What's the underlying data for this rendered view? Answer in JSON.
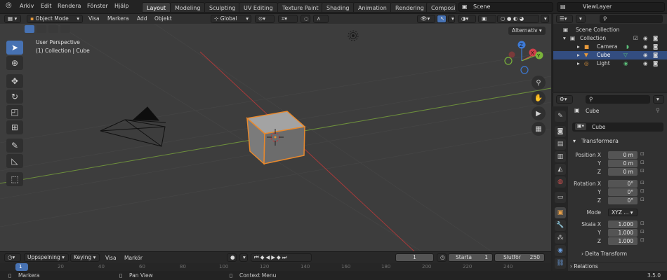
{
  "menubar": {
    "items": [
      "Arkiv",
      "Edit",
      "Rendera",
      "Fönster",
      "Hjälp"
    ],
    "workspace_tabs": [
      "Layout",
      "Modeling",
      "Sculpting",
      "UV Editing",
      "Texture Paint",
      "Shading",
      "Animation",
      "Rendering",
      "Composi"
    ],
    "active_tab": "Layout",
    "scene": "Scene",
    "view_layer": "ViewLayer"
  },
  "viewport_header": {
    "mode": "Object Mode",
    "menus": [
      "Visa",
      "Markera",
      "Add",
      "Objekt"
    ],
    "transform_orientation": "Global"
  },
  "viewport": {
    "view_name": "User Perspective",
    "collection_info": "(1) Collection | Cube",
    "options_button": "Alternativ",
    "gizmo_axes": {
      "x": "X",
      "y": "Y",
      "z": "Z"
    },
    "colors": {
      "x_axis": "#d0404a",
      "y_axis": "#7ab33a",
      "z_axis": "#3d7ad6",
      "selection": "#e8892d"
    }
  },
  "outliner": {
    "root": "Scene Collection",
    "collection": "Collection",
    "objects": [
      {
        "name": "Camera",
        "icon": "camera-icon"
      },
      {
        "name": "Cube",
        "icon": "mesh-icon",
        "selected": true
      },
      {
        "name": "Light",
        "icon": "light-icon"
      }
    ]
  },
  "properties": {
    "object_name": "Cube",
    "datablock_name": "Cube",
    "panel_title": "Transformera",
    "location": {
      "label": "Position X",
      "x": "0 m",
      "y": "0 m",
      "z": "0 m"
    },
    "rotation": {
      "label": "Rotation X",
      "x": "0°",
      "y": "0°",
      "z": "0°"
    },
    "mode": {
      "label": "Mode",
      "value": "XYZ ..."
    },
    "scale": {
      "label": "Skala X",
      "x": "1.000",
      "y": "1.000",
      "z": "1.000"
    },
    "axis_y": "Y",
    "axis_z": "Z",
    "delta_transform": "Delta Transform",
    "relations": "Relations"
  },
  "timeline": {
    "menus": [
      "Uppspelning",
      "Keying",
      "Visa",
      "Markör"
    ],
    "current_frame": "1",
    "start_label": "Starta",
    "start_value": "1",
    "end_label": "Slutför",
    "end_value": "250",
    "ruler_ticks": [
      "1",
      "20",
      "40",
      "60",
      "80",
      "100",
      "120",
      "140",
      "160",
      "180",
      "200",
      "220",
      "240"
    ]
  },
  "statusbar": {
    "select": "Markera",
    "pan": "Pan View",
    "context": "Context Menu",
    "version": "3.5.0"
  }
}
